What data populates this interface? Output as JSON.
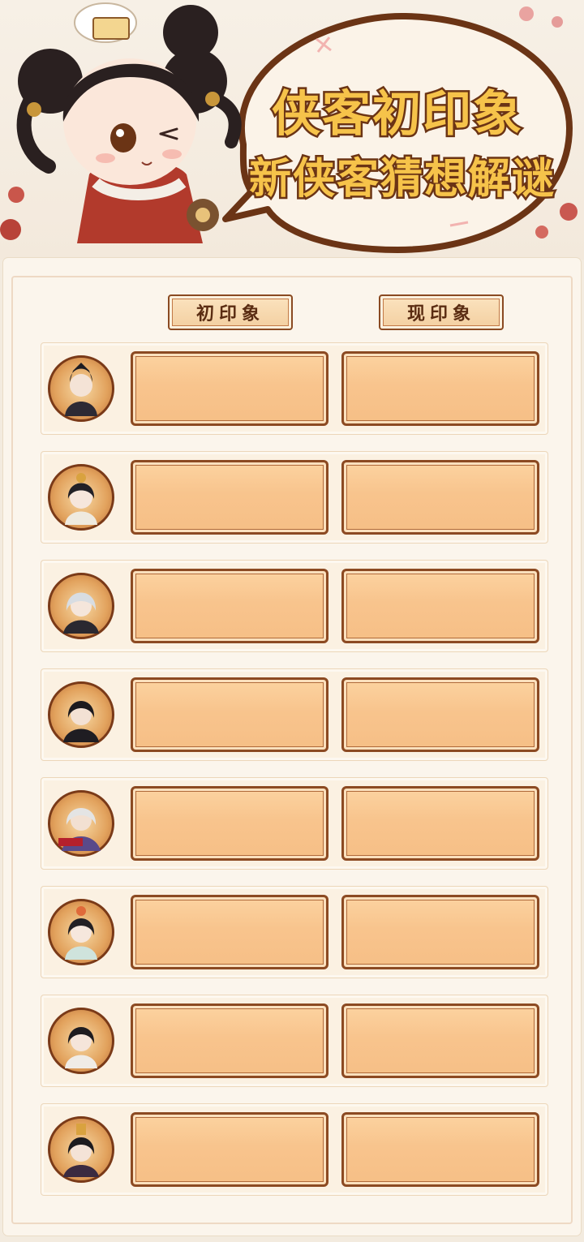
{
  "header": {
    "title_line1": "侠客初印象",
    "title_line2": "新侠客猜想解谜"
  },
  "columns": {
    "first_label": "初印象",
    "now_label": "现印象"
  },
  "rows": [
    {
      "avatar_icon": "hero-avatar-1",
      "first": "",
      "now": ""
    },
    {
      "avatar_icon": "hero-avatar-2",
      "first": "",
      "now": ""
    },
    {
      "avatar_icon": "hero-avatar-3",
      "first": "",
      "now": ""
    },
    {
      "avatar_icon": "hero-avatar-4",
      "first": "",
      "now": ""
    },
    {
      "avatar_icon": "hero-avatar-5",
      "first": "",
      "now": ""
    },
    {
      "avatar_icon": "hero-avatar-6",
      "first": "",
      "now": ""
    },
    {
      "avatar_icon": "hero-avatar-7",
      "first": "",
      "now": ""
    },
    {
      "avatar_icon": "hero-avatar-8",
      "first": "",
      "now": ""
    }
  ],
  "colors": {
    "title_fill": "#f6c34a",
    "title_stroke": "#6b3415",
    "frame_brown": "#8c4a22",
    "cell_fill": "#f8c48d"
  }
}
